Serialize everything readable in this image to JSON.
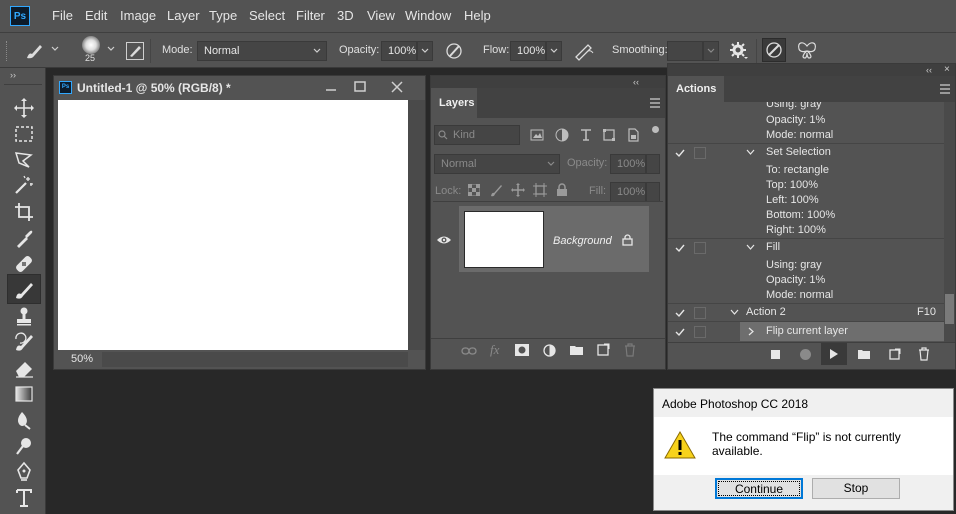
{
  "menu": {
    "app_icon": "Ps",
    "items": [
      "File",
      "Edit",
      "Image",
      "Layer",
      "Type",
      "Select",
      "Filter",
      "3D",
      "View",
      "Window",
      "Help"
    ]
  },
  "options": {
    "brush_size": "25",
    "mode_label": "Mode:",
    "mode_value": "Normal",
    "opacity_label": "Opacity:",
    "opacity_value": "100%",
    "flow_label": "Flow:",
    "flow_value": "100%",
    "smoothing_label": "Smoothing:"
  },
  "document": {
    "icon": "Ps",
    "title": "Untitled-1 @ 50% (RGB/8) *",
    "zoom": "50%"
  },
  "layers": {
    "tab": "Layers",
    "kind": "Kind",
    "blend": "Normal",
    "opacity_label": "Opacity:",
    "opacity_value": "100%",
    "lock_label": "Lock:",
    "fill_label": "Fill:",
    "fill_value": "100%",
    "layer_name": "Background"
  },
  "actions": {
    "tab": "Actions",
    "lines": [
      "Using: gray",
      "Opacity: 1%",
      "Mode: normal",
      "Set Selection",
      "To: rectangle",
      "Top: 100%",
      "Left: 100%",
      "Bottom: 100%",
      "Right: 100%",
      "Fill",
      "Using: gray",
      "Opacity: 1%",
      "Mode: normal",
      "Action 2",
      "F10",
      "Flip current layer"
    ]
  },
  "dialog": {
    "title": "Adobe Photoshop CC 2018",
    "message": "The command “Flip” is not currently available.",
    "continue_label": "Continue",
    "stop_label": "Stop"
  }
}
